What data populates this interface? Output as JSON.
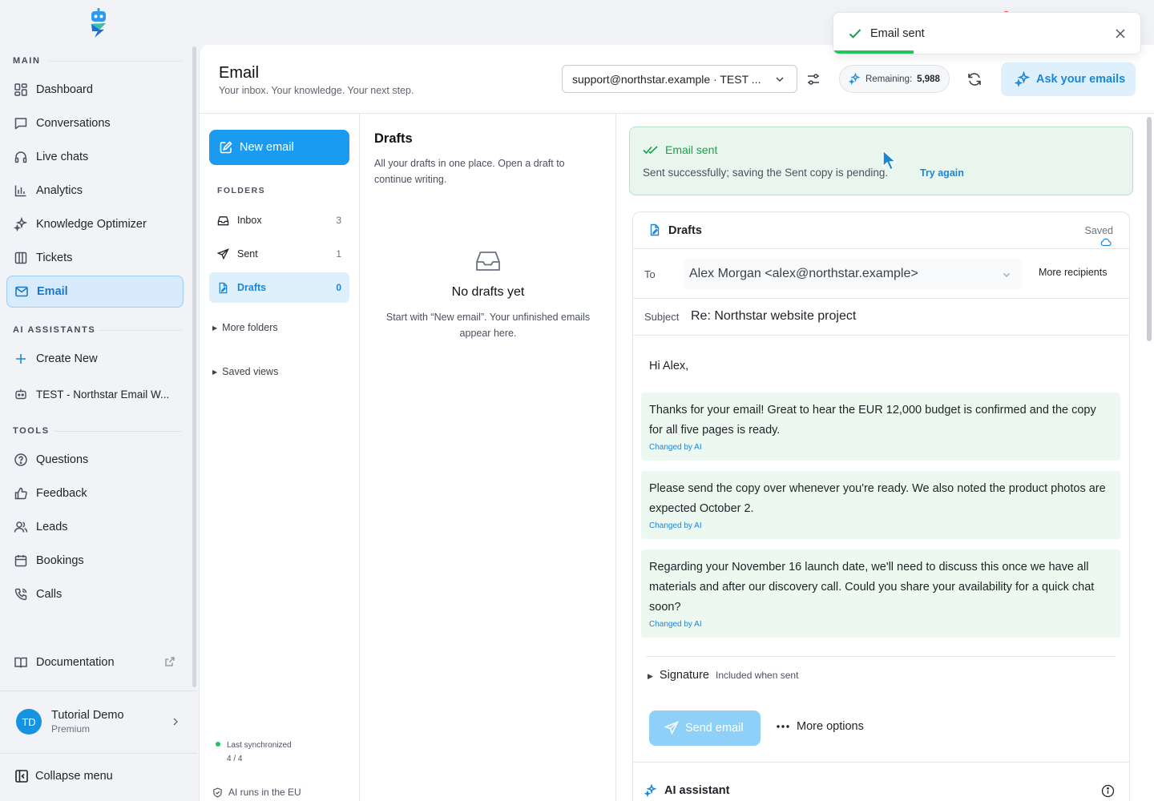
{
  "sidebar": {
    "sections": {
      "main": "MAIN",
      "ai_assistants": "AI ASSISTANTS",
      "tools": "TOOLS"
    },
    "main_items": [
      {
        "label": "Dashboard",
        "icon": "grid-icon"
      },
      {
        "label": "Conversations",
        "icon": "chat-icon"
      },
      {
        "label": "Live chats",
        "icon": "headset-icon"
      },
      {
        "label": "Analytics",
        "icon": "bar-chart-icon"
      },
      {
        "label": "Knowledge Optimizer",
        "icon": "sparkle-icon"
      },
      {
        "label": "Tickets",
        "icon": "columns-icon"
      },
      {
        "label": "Email",
        "icon": "mail-icon",
        "active": true
      }
    ],
    "assistant_items": [
      {
        "label": "Create New",
        "icon": "plus-icon"
      },
      {
        "label": "TEST - Northstar Email W...",
        "icon": "bot-icon"
      }
    ],
    "tool_items": [
      {
        "label": "Questions",
        "icon": "question-icon"
      },
      {
        "label": "Feedback",
        "icon": "thumbs-up-icon"
      },
      {
        "label": "Leads",
        "icon": "users-icon"
      },
      {
        "label": "Bookings",
        "icon": "calendar-icon"
      },
      {
        "label": "Calls",
        "icon": "phone-icon"
      }
    ],
    "documentation": "Documentation",
    "user": {
      "initials": "TD",
      "name": "Tutorial Demo",
      "plan": "Premium"
    },
    "collapse": "Collapse menu"
  },
  "header": {
    "title": "Email",
    "subtitle": "Your inbox. Your knowledge. Your next step.",
    "account_select": "support@northstar.example · TEST ...",
    "remaining_label": "Remaining:",
    "remaining_value": "5,988",
    "ask_button": "Ask your emails"
  },
  "folders": {
    "new_email": "New email",
    "title": "FOLDERS",
    "items": [
      {
        "label": "Inbox",
        "count": "3",
        "icon": "inbox-icon"
      },
      {
        "label": "Sent",
        "count": "1",
        "icon": "send-icon"
      },
      {
        "label": "Drafts",
        "count": "0",
        "icon": "draft-icon",
        "active": true
      }
    ],
    "more_folders": "More folders",
    "saved_views": "Saved views",
    "sync_label": "Last synchronized",
    "sync_count": "4 / 4",
    "eu_note": "AI runs in the EU"
  },
  "draft_list": {
    "title": "Drafts",
    "description": "All your drafts in one place. Open a draft to continue writing.",
    "empty_title": "No drafts yet",
    "empty_desc": "Start with “New email”. Your unfinished emails appear here."
  },
  "banner": {
    "title": "Email sent",
    "message": "Sent successfully; saving the Sent copy is pending.",
    "retry": "Try again"
  },
  "composer": {
    "title": "Drafts",
    "saved": "Saved",
    "to_label": "To",
    "to_value": "Alex Morgan <alex@northstar.example>",
    "more_recipients": "More recipients",
    "subject_label": "Subject",
    "subject_value": "Re: Northstar website project",
    "greeting": "Hi Alex,",
    "paragraphs": [
      {
        "text": "Thanks for your email! Great to hear the EUR 12,000 budget is confirmed and the copy for all five pages is ready.",
        "tag": "Changed by AI"
      },
      {
        "text": "Please send the copy over whenever you're ready. We also noted the product photos are expected October 2.",
        "tag": "Changed by AI"
      },
      {
        "text": "Regarding your November 16 launch date, we'll need to discuss this once we have all materials and after our discovery call. Could you share your availability for a quick chat soon?",
        "tag": "Changed by AI"
      }
    ],
    "signature": "Signature",
    "signature_note": "Included when sent",
    "send_button": "Send email",
    "more_options": "More options",
    "ai_assistant": "AI assistant"
  },
  "toast": {
    "text": "Email sent",
    "progress": 0.26
  },
  "colors": {
    "accent": "#1b9bf0",
    "success": "#16a34a",
    "active_nav_bg": "#d8ebfc"
  }
}
